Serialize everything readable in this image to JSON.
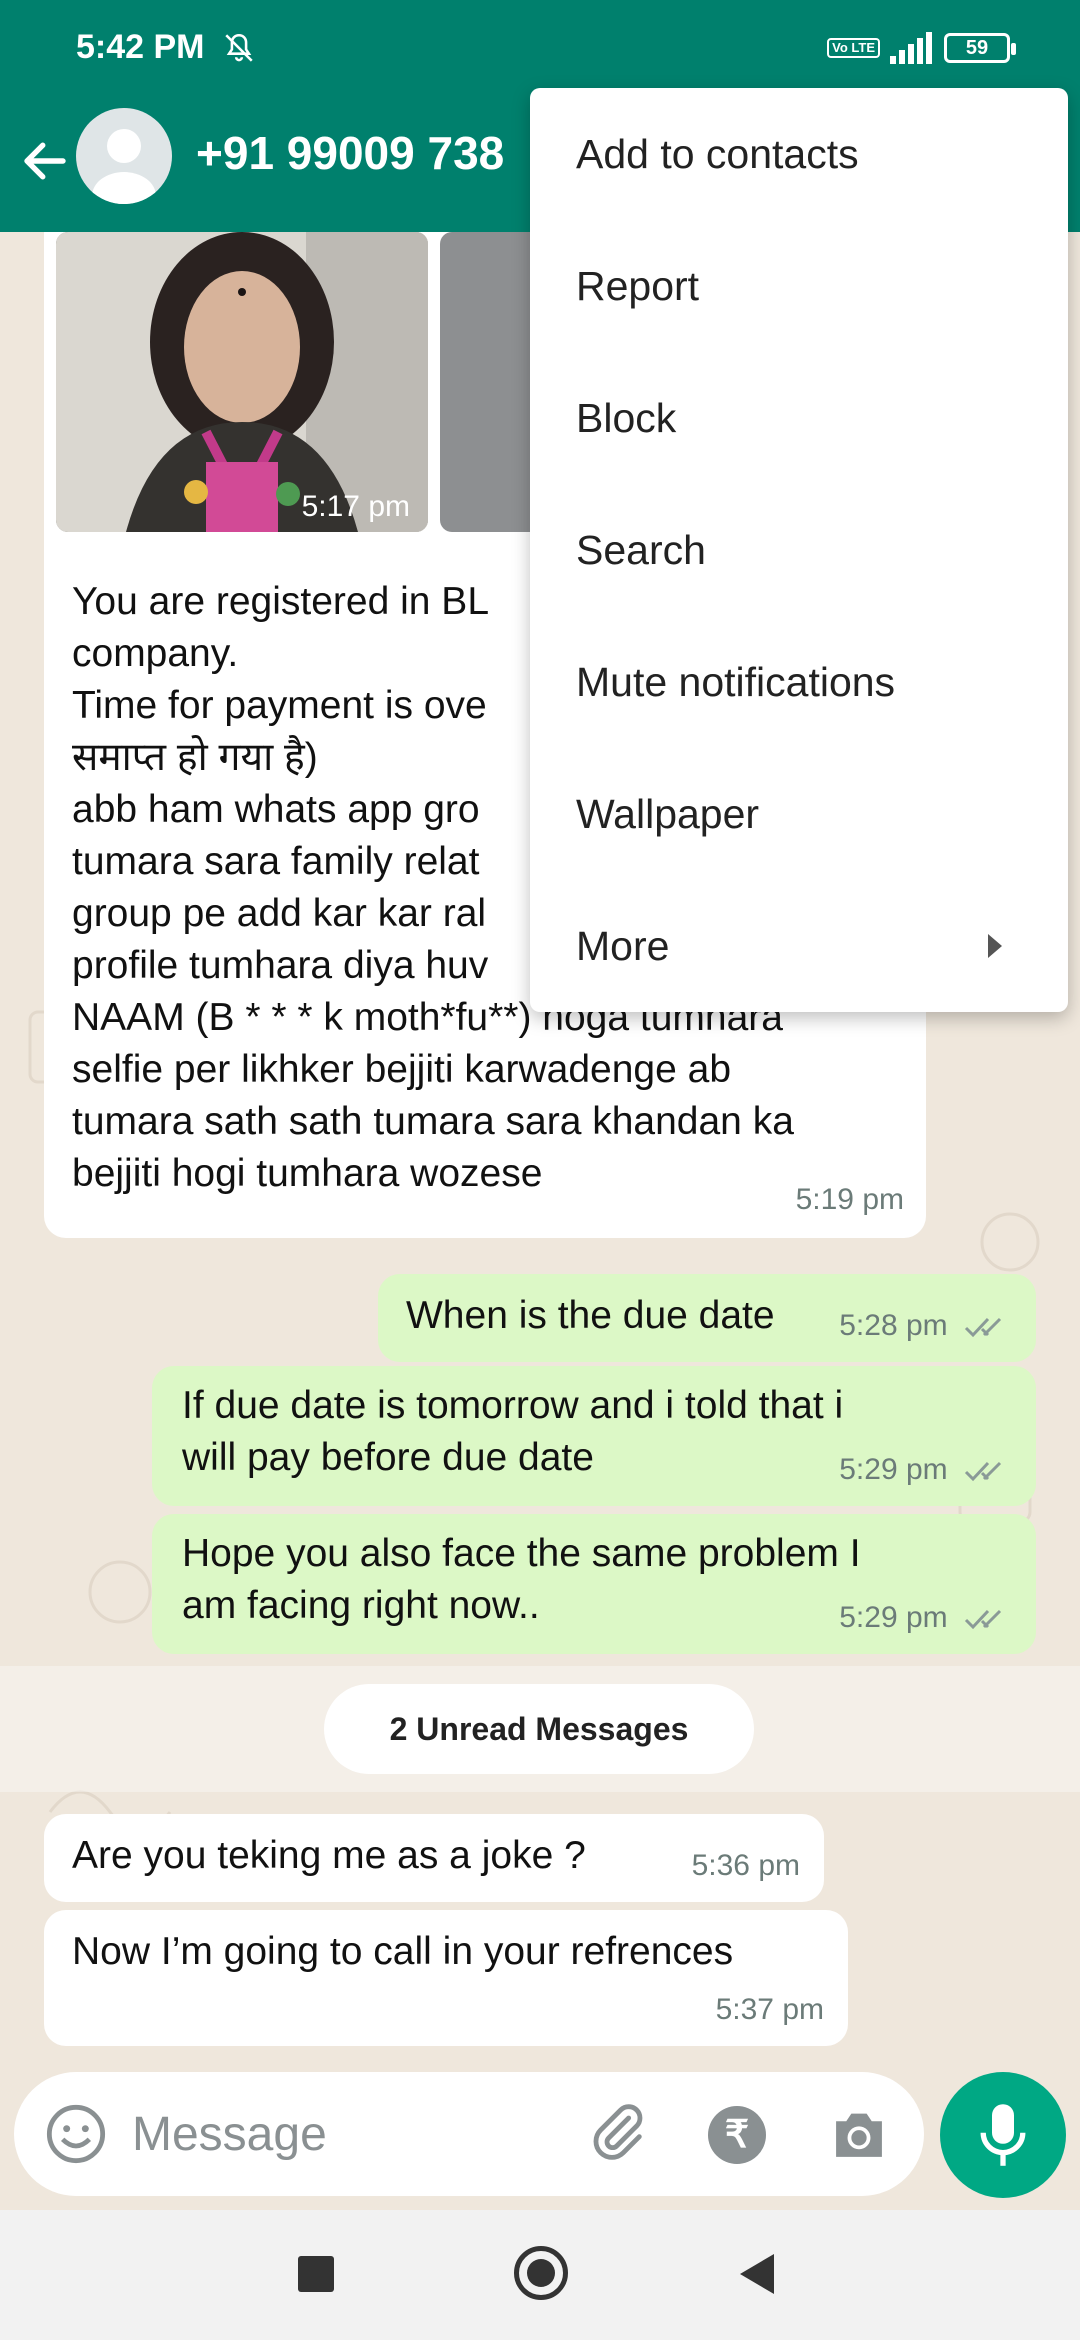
{
  "status_bar": {
    "time": "5:42 PM",
    "volte": "Vo LTE",
    "battery": "59",
    "battery_level": 0.59
  },
  "header": {
    "contact_name": "+91 99009 738"
  },
  "chat": {
    "media": {
      "time": "5:17 pm"
    },
    "messages_in_top": {
      "lines": [
        "You are registered in BL",
        "company.",
        "Time for payment is ove",
        "समाप्त हो गया है)",
        "abb ham whats app gro",
        "tumara sara family relat",
        "group pe add kar kar ral",
        "profile tumhara diya huv",
        "NAAM (B * * * k moth*fu**) hoga tumhara",
        "selfie per likhker bejjiti karwadenge ab",
        "tumara sath sath tumara sara khandan ka",
        "bejjiti hogi tumhara wozese"
      ],
      "time": "5:19 pm"
    },
    "out_1": {
      "text": "When is the due date",
      "time": "5:28 pm"
    },
    "out_2": {
      "line1": "If due date is tomorrow and i told that i",
      "line2": "will pay before due date",
      "time": "5:29 pm"
    },
    "out_3": {
      "line1": "Hope you also face the same problem I",
      "line2": "am facing right now..",
      "time": "5:29 pm"
    },
    "unread": "2 Unread Messages",
    "in_1": {
      "text": "Are you teking me as a joke ?",
      "time": "5:36 pm"
    },
    "in_2": {
      "text": "Now I’m going to call in your refrences",
      "time": "5:37 pm"
    }
  },
  "input": {
    "placeholder": "Message"
  },
  "menu": {
    "items": [
      "Add to contacts",
      "Report",
      "Block",
      "Search",
      "Mute notifications",
      "Wallpaper",
      "More"
    ]
  },
  "colors": {
    "header": "#00806d",
    "outgoing_bubble": "#dcf8c6",
    "incoming_bubble": "#ffffff",
    "chat_background": "#efe7dc",
    "mic_button": "#00a884",
    "read_ticks": "#8a9a97"
  },
  "icons": [
    "muted-bell-icon",
    "signal-icon",
    "back-arrow-icon",
    "emoji-icon",
    "attach-icon",
    "rupee-icon",
    "camera-icon",
    "mic-icon",
    "double-tick-icon",
    "submenu-arrow-icon"
  ]
}
